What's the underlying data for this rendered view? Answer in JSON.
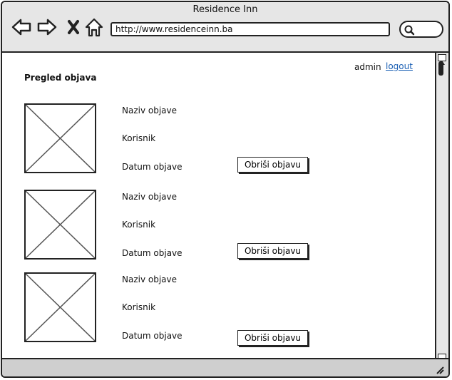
{
  "window": {
    "title": "Residence Inn"
  },
  "address_bar": {
    "url": "http://www.residenceinn.ba"
  },
  "nav_icons": [
    "back-arrow-icon",
    "forward-arrow-icon",
    "close-x-icon",
    "home-icon"
  ],
  "page": {
    "title": "Pregled objava"
  },
  "user": {
    "name": "admin",
    "logout_label": "logout"
  },
  "posts": [
    {
      "title_label": "Naziv objave",
      "user_label": "Korisnik",
      "date_label": "Datum objave",
      "delete_label": "Obriši objavu"
    },
    {
      "title_label": "Naziv objave",
      "user_label": "Korisnik",
      "date_label": "Datum objave",
      "delete_label": "Obriši objavu"
    },
    {
      "title_label": "Naziv objave",
      "user_label": "Korisnik",
      "date_label": "Datum objave",
      "delete_label": "Obriši objavu"
    }
  ]
}
